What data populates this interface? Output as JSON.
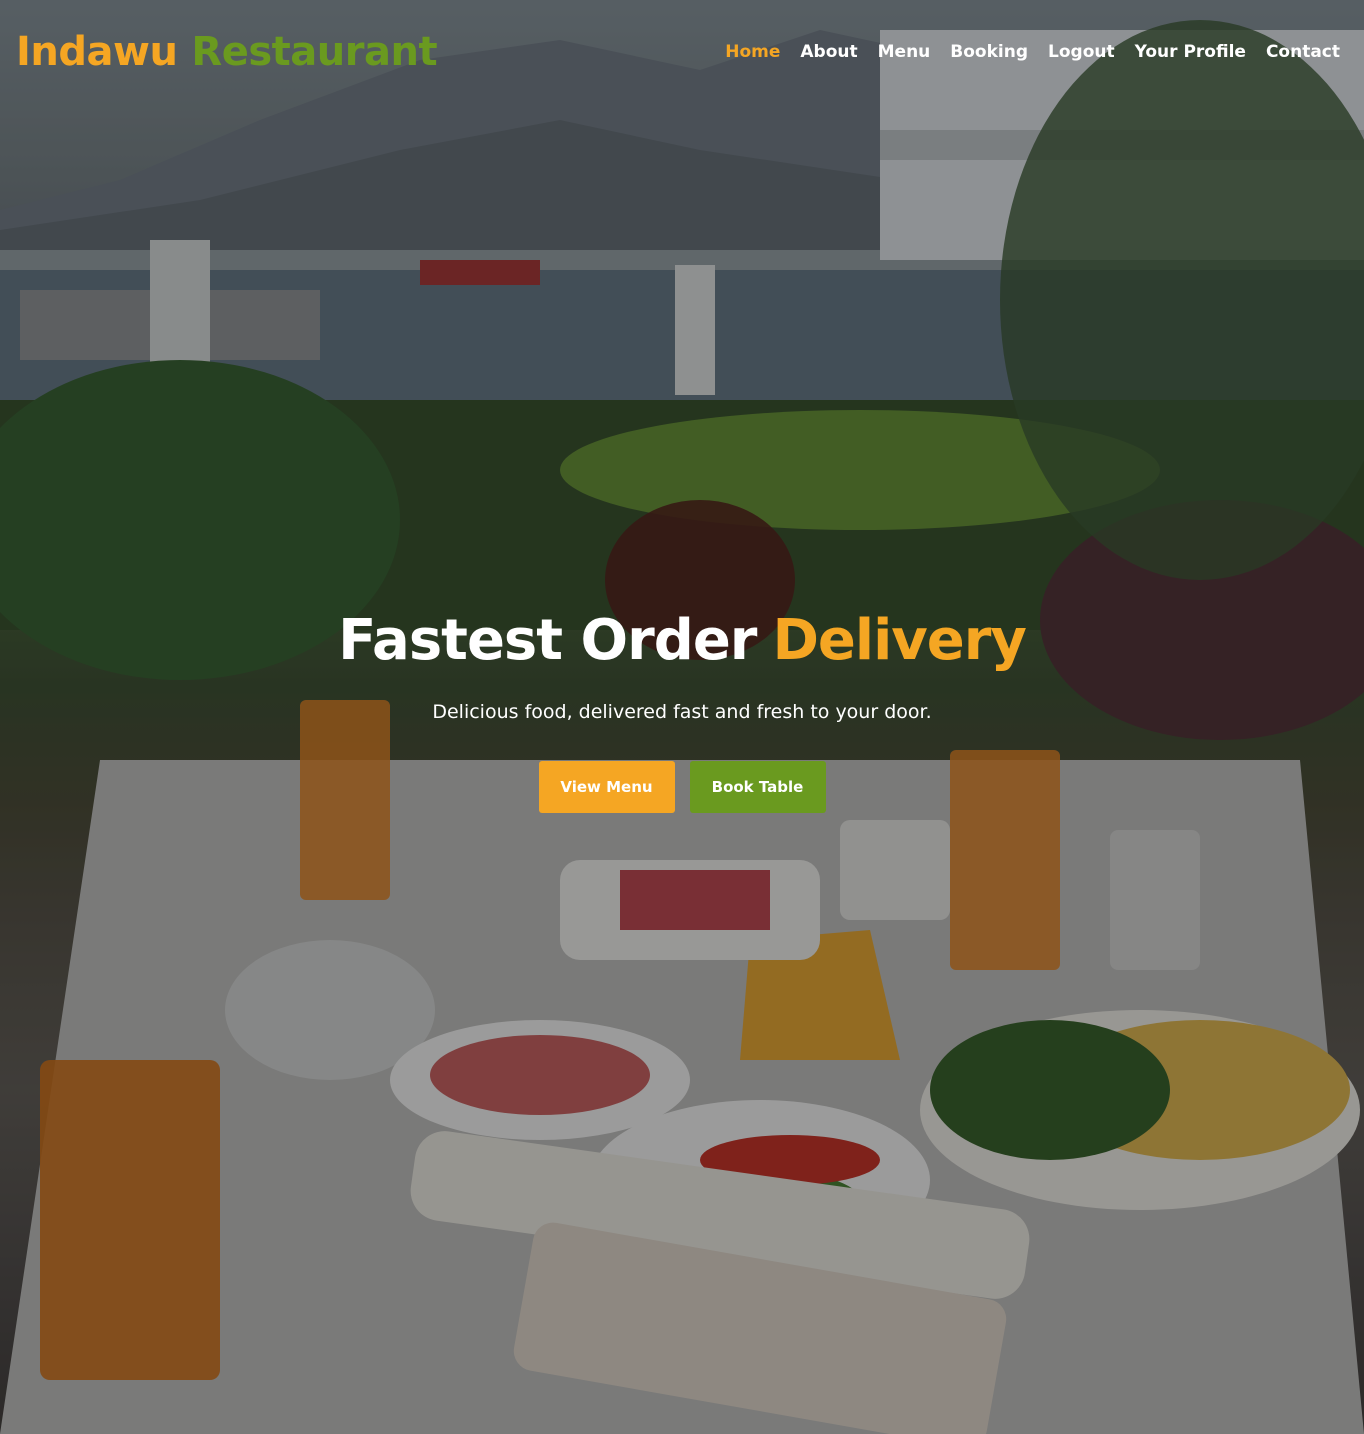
{
  "brand": {
    "part1": "Indawu",
    "part2": "Restaurant"
  },
  "nav": {
    "items": [
      {
        "label": "Home",
        "active": true
      },
      {
        "label": "About"
      },
      {
        "label": "Menu"
      },
      {
        "label": "Booking"
      },
      {
        "label": "Logout"
      },
      {
        "label": "Your Profile"
      },
      {
        "label": "Contact"
      }
    ]
  },
  "hero": {
    "title_main": "Fastest Order",
    "title_accent": "Delivery",
    "subtitle": "Delicious food, delivered fast and fresh to your door.",
    "buttons": {
      "view_menu": "View Menu",
      "book_table": "Book Table"
    }
  },
  "colors": {
    "accent_orange": "#f5a623",
    "accent_green": "#6a9a1f",
    "nav_text": "#ffffff"
  }
}
